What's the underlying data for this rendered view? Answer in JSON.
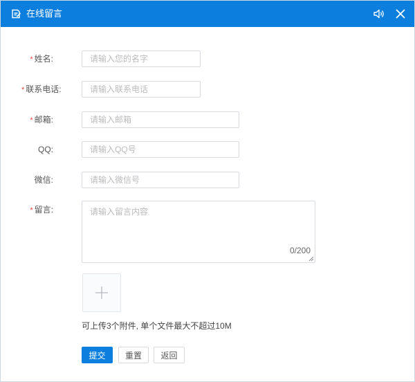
{
  "window": {
    "title": "在线留言",
    "icons": {
      "title": "edit-note-icon",
      "sound": "speaker-icon",
      "close": "close-icon"
    },
    "colors": {
      "header": "#0c7fde",
      "required": "#e0453b",
      "primary": "#0c7fde"
    }
  },
  "form": {
    "required_mark": "*",
    "name": {
      "label": "姓名:",
      "placeholder": "请输入您的名字"
    },
    "phone": {
      "label": "联系电话:",
      "placeholder": "请输入联系电话"
    },
    "email": {
      "label": "邮箱:",
      "placeholder": "请输入邮箱"
    },
    "qq": {
      "label": "QQ:",
      "placeholder": "请输入QQ号"
    },
    "wechat": {
      "label": "微信:",
      "placeholder": "请输入微信号"
    },
    "message": {
      "label": "留言:",
      "placeholder": "请输入留言内容",
      "counter": "0/200"
    }
  },
  "upload": {
    "icon": "plus-icon",
    "hint": "可上传3个附件, 单个文件最大不超过10M"
  },
  "buttons": {
    "submit": "提交",
    "reset": "重置",
    "back": "返回"
  }
}
